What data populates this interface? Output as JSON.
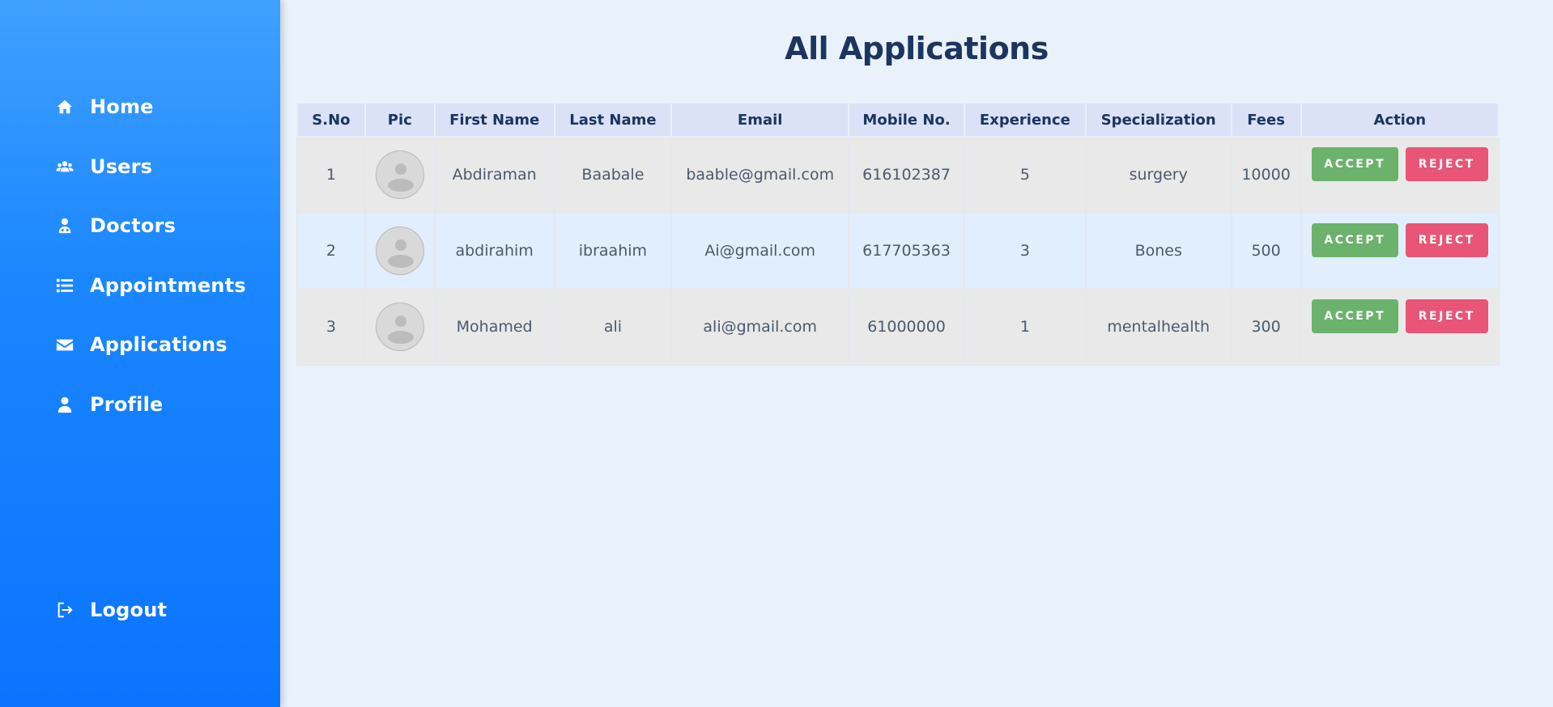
{
  "sidebar": {
    "items": [
      {
        "label": "Home",
        "icon": "home-icon"
      },
      {
        "label": "Users",
        "icon": "users-icon"
      },
      {
        "label": "Doctors",
        "icon": "doctor-icon"
      },
      {
        "label": "Appointments",
        "icon": "list-icon"
      },
      {
        "label": "Applications",
        "icon": "envelope-icon"
      },
      {
        "label": "Profile",
        "icon": "user-icon"
      }
    ],
    "logout": {
      "label": "Logout",
      "icon": "logout-icon"
    }
  },
  "main": {
    "title": "All Applications",
    "table": {
      "headers": [
        "S.No",
        "Pic",
        "First Name",
        "Last Name",
        "Email",
        "Mobile No.",
        "Experience",
        "Specialization",
        "Fees",
        "Action"
      ],
      "rows": [
        {
          "sno": "1",
          "first_name": "Abdiraman",
          "last_name": "Baabale",
          "email": "baable@gmail.com",
          "mobile": "616102387",
          "experience": "5",
          "specialization": "surgery",
          "fees": "10000"
        },
        {
          "sno": "2",
          "first_name": "abdirahim",
          "last_name": "ibraahim",
          "email": "Ai@gmail.com",
          "mobile": "617705363",
          "experience": "3",
          "specialization": "Bones",
          "fees": "500"
        },
        {
          "sno": "3",
          "first_name": "Mohamed",
          "last_name": "ali",
          "email": "ali@gmail.com",
          "mobile": "61000000",
          "experience": "1",
          "specialization": "mentalhealth",
          "fees": "300"
        }
      ],
      "accept_label": "ACCEPT",
      "reject_label": "REJECT"
    }
  },
  "colors": {
    "sidebar_top": "#3fa0ff",
    "sidebar_bottom": "#0a74ff",
    "accept": "#6bb26d",
    "reject": "#e85577",
    "title": "#1c3560"
  }
}
